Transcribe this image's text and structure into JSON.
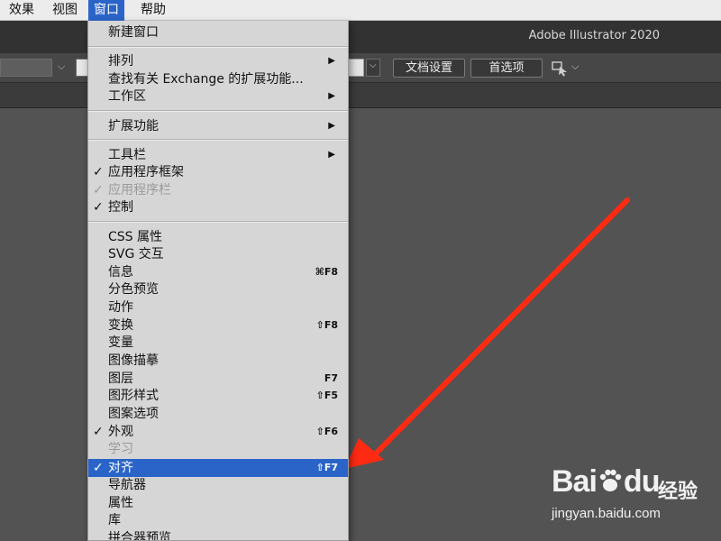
{
  "menubar": {
    "items": [
      {
        "label": "效果"
      },
      {
        "label": "视图"
      },
      {
        "label": "窗口"
      },
      {
        "label": "帮助"
      }
    ],
    "active_index": 2
  },
  "titlebar": {
    "app_title": "Adobe Illustrator 2020"
  },
  "controlbar": {
    "document_setup_label": "文档设置",
    "preferences_label": "首选项"
  },
  "menu": {
    "items": [
      {
        "label": "新建窗口"
      },
      {
        "label": "排列",
        "submenu": true
      },
      {
        "label": "查找有关 Exchange 的扩展功能..."
      },
      {
        "label": "工作区",
        "submenu": true
      },
      {
        "label": "扩展功能",
        "submenu": true
      },
      {
        "label": "工具栏",
        "submenu": true
      },
      {
        "label": "应用程序框架",
        "checked": true
      },
      {
        "label": "应用程序栏",
        "checked": true,
        "disabled": true
      },
      {
        "label": "控制",
        "checked": true
      },
      {
        "label": "CSS 属性"
      },
      {
        "label": "SVG 交互"
      },
      {
        "label": "信息",
        "shortcut": "⌘F8"
      },
      {
        "label": "分色预览"
      },
      {
        "label": "动作"
      },
      {
        "label": "变换",
        "shortcut": "⇧F8"
      },
      {
        "label": "变量"
      },
      {
        "label": "图像描摹"
      },
      {
        "label": "图层",
        "shortcut": "F7"
      },
      {
        "label": "图形样式",
        "shortcut": "⇧F5"
      },
      {
        "label": "图案选项"
      },
      {
        "label": "外观",
        "checked": true,
        "shortcut": "⇧F6"
      },
      {
        "label": "学习",
        "disabled": true
      },
      {
        "label": "对齐",
        "checked": true,
        "shortcut": "⇧F7",
        "highlighted": true
      },
      {
        "label": "导航器"
      },
      {
        "label": "属性"
      },
      {
        "label": "库"
      },
      {
        "label": "拼合器预览"
      }
    ],
    "checkmark": "✓",
    "submenu_arrow": "▶"
  },
  "watermark": {
    "logo_text_a": "Bai",
    "logo_text_b": "du",
    "brand_cn": "经验",
    "url": "jingyan.baidu.com"
  },
  "colors": {
    "highlight": "#2a64c8",
    "arrow": "#ff2a12"
  }
}
